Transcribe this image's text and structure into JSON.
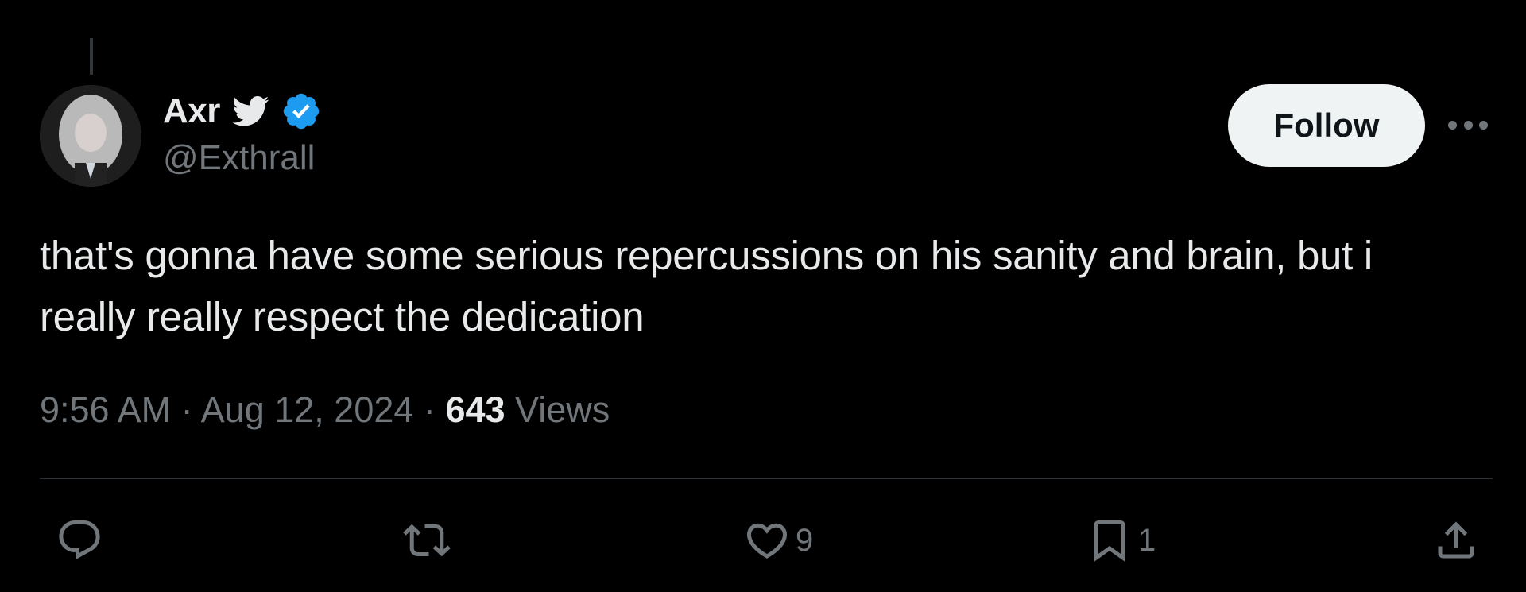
{
  "tweet": {
    "author": {
      "display_name": "Axr",
      "handle": "@Exthrall",
      "verified": true,
      "badge_icons": [
        "twitter-bird-icon",
        "verified-badge-icon"
      ],
      "avatar_alt": "Profile picture of Axr"
    },
    "follow_label": "Follow",
    "more_icon": "more-horizontal-icon",
    "text": "that's gonna have some serious repercussions on his sanity and brain, but i really really respect the dedication",
    "time": "9:56 AM",
    "separator": "·",
    "date": "Aug 12, 2024",
    "views_count": "643",
    "views_label": "Views",
    "actions": {
      "reply": {
        "icon": "reply-icon",
        "count": ""
      },
      "retweet": {
        "icon": "retweet-icon",
        "count": ""
      },
      "like": {
        "icon": "heart-icon",
        "count": "9"
      },
      "bookmark": {
        "icon": "bookmark-icon",
        "count": "1"
      },
      "share": {
        "icon": "share-icon",
        "count": ""
      }
    }
  },
  "colors": {
    "background": "#000000",
    "primary_text": "#e7e9ea",
    "secondary_text": "#71767b",
    "verified_blue": "#1d9bf0",
    "follow_bg": "#eff3f4",
    "divider": "#2f3336"
  }
}
